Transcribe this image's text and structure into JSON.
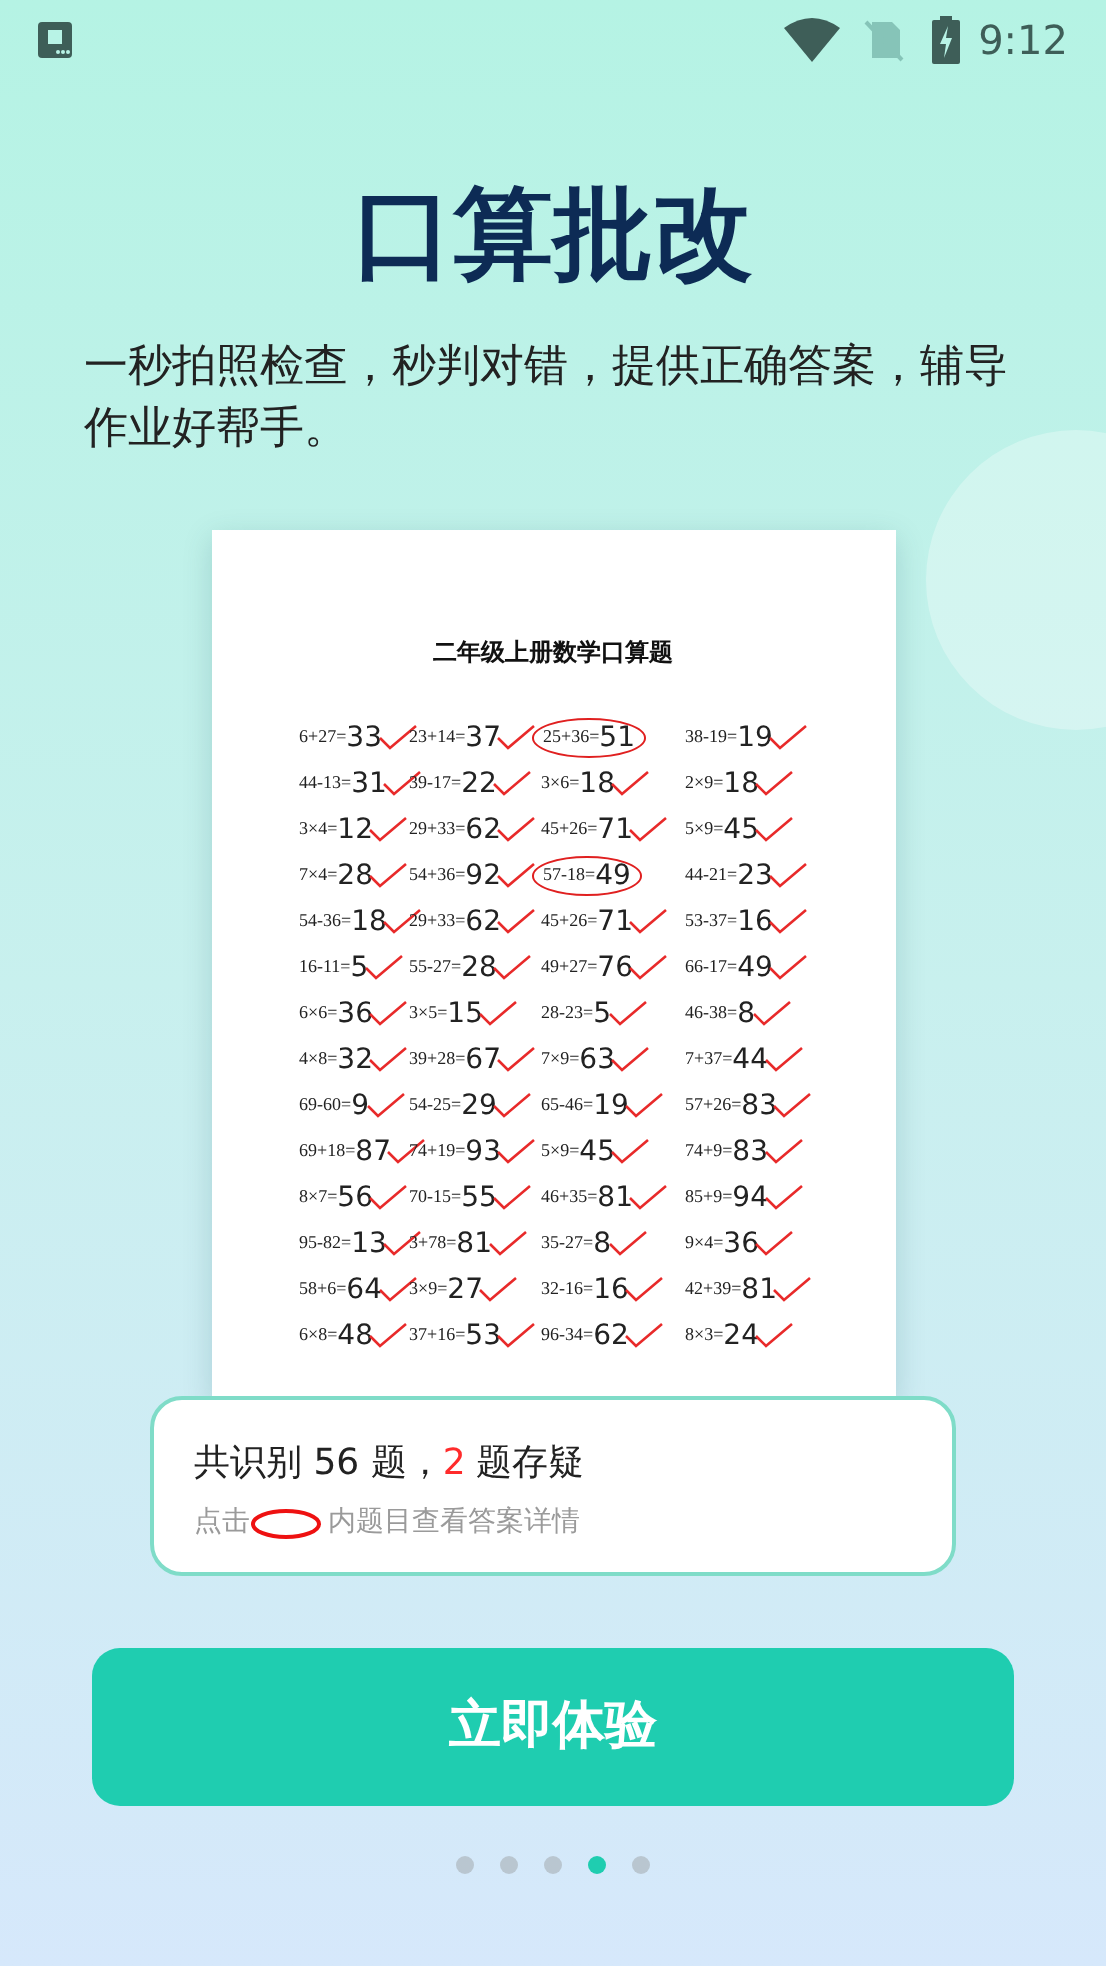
{
  "status_bar": {
    "time": "9:12"
  },
  "title": "口算批改",
  "subtitle": "一秒拍照检查，秒判对错，提供正确答案，辅导作业好帮手。",
  "worksheet": {
    "title": "二年级上册数学口算题",
    "rows": [
      [
        {
          "q": "6+27=",
          "a": "33",
          "flagged": false
        },
        {
          "q": "23+14=",
          "a": "37",
          "flagged": false
        },
        {
          "q": "25+36=",
          "a": "51",
          "flagged": true
        },
        {
          "q": "38-19=",
          "a": "19",
          "flagged": false
        }
      ],
      [
        {
          "q": "44-13=",
          "a": "31",
          "flagged": false
        },
        {
          "q": "39-17=",
          "a": "22",
          "flagged": false
        },
        {
          "q": "3×6=",
          "a": "18",
          "flagged": false
        },
        {
          "q": "2×9=",
          "a": "18",
          "flagged": false
        }
      ],
      [
        {
          "q": "3×4=",
          "a": "12",
          "flagged": false
        },
        {
          "q": "29+33=",
          "a": "62",
          "flagged": false
        },
        {
          "q": "45+26=",
          "a": "71",
          "flagged": false
        },
        {
          "q": "5×9=",
          "a": "45",
          "flagged": false
        }
      ],
      [
        {
          "q": "7×4=",
          "a": "28",
          "flagged": false
        },
        {
          "q": "54+36=",
          "a": "92",
          "flagged": false
        },
        {
          "q": "57-18=",
          "a": "49",
          "flagged": true
        },
        {
          "q": "44-21=",
          "a": "23",
          "flagged": false
        }
      ],
      [
        {
          "q": "54-36=",
          "a": "18",
          "flagged": false
        },
        {
          "q": "29+33=",
          "a": "62",
          "flagged": false
        },
        {
          "q": "45+26=",
          "a": "71",
          "flagged": false
        },
        {
          "q": "53-37=",
          "a": "16",
          "flagged": false
        }
      ],
      [
        {
          "q": "16-11=",
          "a": "5",
          "flagged": false
        },
        {
          "q": "55-27=",
          "a": "28",
          "flagged": false
        },
        {
          "q": "49+27=",
          "a": "76",
          "flagged": false
        },
        {
          "q": "66-17=",
          "a": "49",
          "flagged": false
        }
      ],
      [
        {
          "q": "6×6=",
          "a": "36",
          "flagged": false
        },
        {
          "q": "3×5=",
          "a": "15",
          "flagged": false
        },
        {
          "q": "28-23=",
          "a": "5",
          "flagged": false
        },
        {
          "q": "46-38=",
          "a": "8",
          "flagged": false
        }
      ],
      [
        {
          "q": "4×8=",
          "a": "32",
          "flagged": false
        },
        {
          "q": "39+28=",
          "a": "67",
          "flagged": false
        },
        {
          "q": "7×9=",
          "a": "63",
          "flagged": false
        },
        {
          "q": "7+37=",
          "a": "44",
          "flagged": false
        }
      ],
      [
        {
          "q": "69-60=",
          "a": "9",
          "flagged": false
        },
        {
          "q": "54-25=",
          "a": "29",
          "flagged": false
        },
        {
          "q": "65-46=",
          "a": "19",
          "flagged": false
        },
        {
          "q": "57+26=",
          "a": "83",
          "flagged": false
        }
      ],
      [
        {
          "q": "69+18=",
          "a": "87",
          "flagged": false
        },
        {
          "q": "74+19=",
          "a": "93",
          "flagged": false
        },
        {
          "q": "5×9=",
          "a": "45",
          "flagged": false
        },
        {
          "q": "74+9=",
          "a": "83",
          "flagged": false
        }
      ],
      [
        {
          "q": "8×7=",
          "a": "56",
          "flagged": false
        },
        {
          "q": "70-15=",
          "a": "55",
          "flagged": false
        },
        {
          "q": "46+35=",
          "a": "81",
          "flagged": false
        },
        {
          "q": "85+9=",
          "a": "94",
          "flagged": false
        }
      ],
      [
        {
          "q": "95-82=",
          "a": "13",
          "flagged": false
        },
        {
          "q": "3+78=",
          "a": "81",
          "flagged": false
        },
        {
          "q": "35-27=",
          "a": "8",
          "flagged": false
        },
        {
          "q": "9×4=",
          "a": "36",
          "flagged": false
        }
      ],
      [
        {
          "q": "58+6=",
          "a": "64",
          "flagged": false
        },
        {
          "q": "3×9=",
          "a": "27",
          "flagged": false
        },
        {
          "q": "32-16=",
          "a": "16",
          "flagged": false
        },
        {
          "q": "42+39=",
          "a": "81",
          "flagged": false
        }
      ],
      [
        {
          "q": "6×8=",
          "a": "48",
          "flagged": false
        },
        {
          "q": "37+16=",
          "a": "53",
          "flagged": false
        },
        {
          "q": "96-34=",
          "a": "62",
          "flagged": false
        },
        {
          "q": "8×3=",
          "a": "24",
          "flagged": false
        }
      ]
    ]
  },
  "result_card": {
    "summary_prefix": "共识别 56 题，",
    "doubt_count": "2",
    "summary_suffix": "题存疑",
    "hint_prefix": "点击",
    "hint_suffix": "内题目查看答案详情"
  },
  "button": "立即体验",
  "pager": [
    {
      "selected": false
    },
    {
      "selected": false
    },
    {
      "selected": false
    },
    {
      "selected": true
    },
    {
      "selected": false
    }
  ]
}
